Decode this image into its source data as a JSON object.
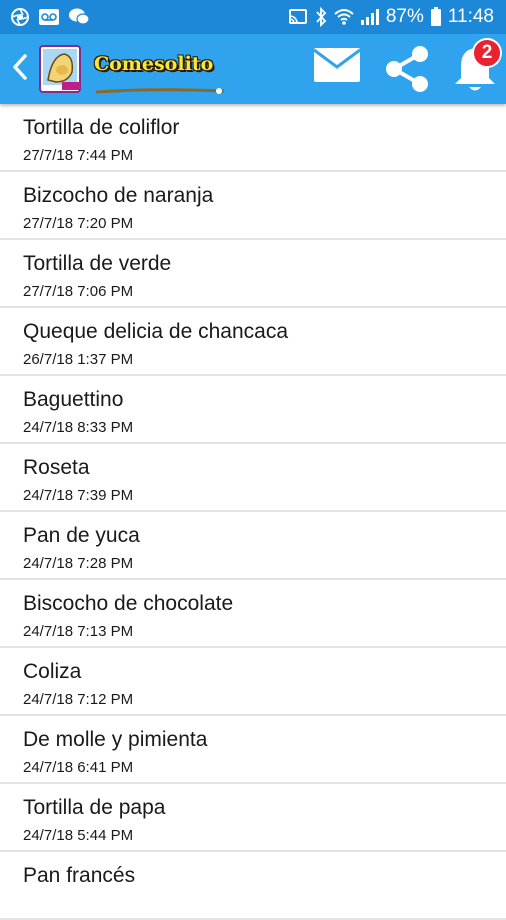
{
  "status_bar": {
    "battery_percent": "87%",
    "time": "11:48",
    "icons_left": [
      "aperture-icon",
      "voicemail-icon",
      "chat-icon"
    ],
    "icons_right": [
      "cast-icon",
      "bluetooth-icon",
      "wifi-icon",
      "signal-icon",
      "battery-icon"
    ]
  },
  "app_bar": {
    "title": "Comesolito",
    "notification_count": "2",
    "colors": {
      "status_bar": "#1e88d8",
      "app_bar": "#2fa3ee",
      "title": "#f6e83a",
      "badge": "#e8222e"
    },
    "icons": [
      "back-arrow-icon",
      "mail-icon",
      "share-icon",
      "bell-icon"
    ]
  },
  "recipes": [
    {
      "title": "Tortilla de coliflor",
      "date": "27/7/18 7:44 PM"
    },
    {
      "title": "Bizcocho de naranja",
      "date": "27/7/18 7:20 PM"
    },
    {
      "title": "Tortilla de verde",
      "date": "27/7/18 7:06 PM"
    },
    {
      "title": "Queque delicia de chancaca",
      "date": "26/7/18 1:37 PM"
    },
    {
      "title": "Baguettino",
      "date": "24/7/18 8:33 PM"
    },
    {
      "title": "Roseta",
      "date": "24/7/18 7:39 PM"
    },
    {
      "title": "Pan de yuca",
      "date": "24/7/18 7:28 PM"
    },
    {
      "title": "Biscocho de chocolate",
      "date": "24/7/18 7:13 PM"
    },
    {
      "title": "Coliza",
      "date": "24/7/18 7:12 PM"
    },
    {
      "title": "De molle y pimienta",
      "date": "24/7/18 6:41 PM"
    },
    {
      "title": "Tortilla de papa",
      "date": "24/7/18 5:44 PM"
    },
    {
      "title": "Pan francés",
      "date": ""
    }
  ]
}
